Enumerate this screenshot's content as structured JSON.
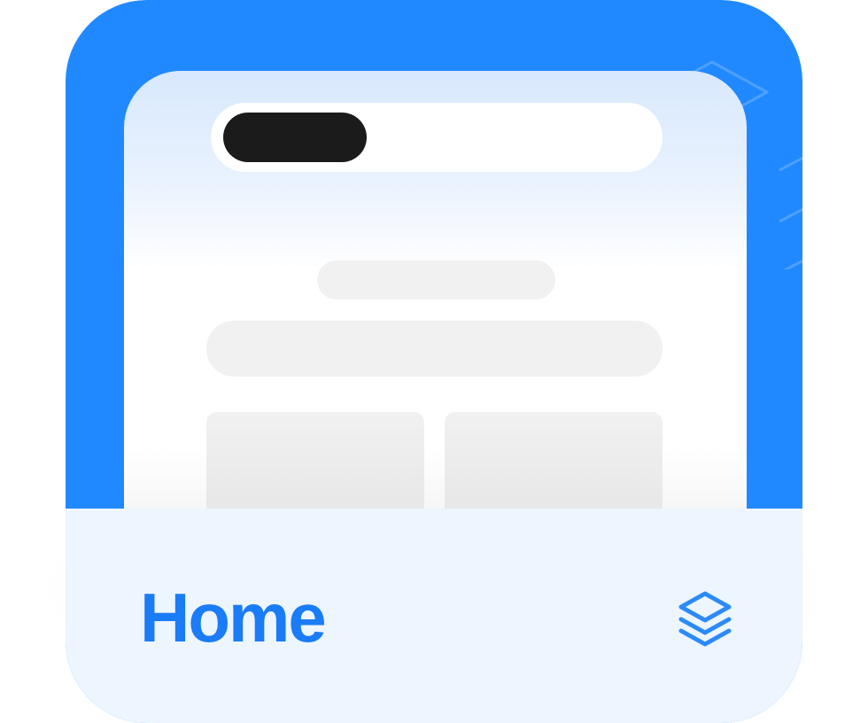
{
  "card": {
    "label": "Home",
    "icon": "layers-icon"
  },
  "colors": {
    "card_background": "#2189ff",
    "footer_background": "#edf5fe",
    "label": "#1a7cf6",
    "icon": "#2c8af8",
    "dark_pill": "#1b1b1b",
    "placeholder": "#f1f1f1"
  },
  "decorative": {
    "background_icon": "layers-outline-icon"
  }
}
